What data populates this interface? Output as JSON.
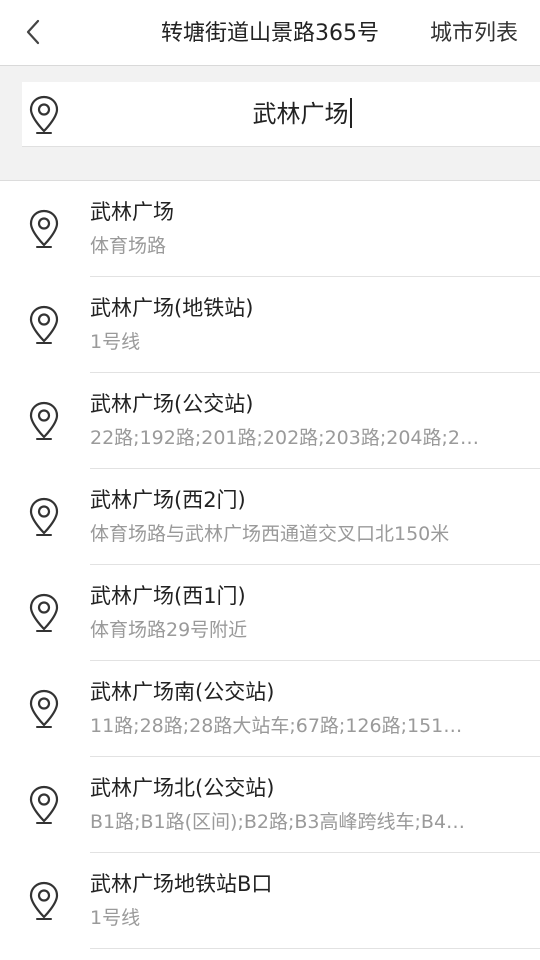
{
  "header": {
    "back_icon": "chevron-left-icon",
    "title": "转塘街道山景路365号",
    "city_list_label": "城市列表"
  },
  "search": {
    "icon": "location-pin-icon",
    "value": "武林广场"
  },
  "results": [
    {
      "title": "武林广场",
      "subtitle": "体育场路"
    },
    {
      "title": "武林广场(地铁站)",
      "subtitle": "1号线"
    },
    {
      "title": "武林广场(公交站)",
      "subtitle": "22路;192路;201路;202路;203路;204路;2…"
    },
    {
      "title": "武林广场(西2门)",
      "subtitle": "体育场路与武林广场西通道交叉口北150米"
    },
    {
      "title": "武林广场(西1门)",
      "subtitle": "体育场路29号附近"
    },
    {
      "title": "武林广场南(公交站)",
      "subtitle": "11路;28路;28路大站车;67路;126路;151…"
    },
    {
      "title": "武林广场北(公交站)",
      "subtitle": "B1路;B1路(区间);B2路;B3高峰跨线车;B4…"
    },
    {
      "title": "武林广场地铁站B口",
      "subtitle": "1号线"
    }
  ],
  "colors": {
    "background": "#ffffff",
    "band": "#f2f2f2",
    "primary_text": "#222222",
    "secondary_text": "#9a9a9a",
    "divider": "#e2e2e2"
  }
}
